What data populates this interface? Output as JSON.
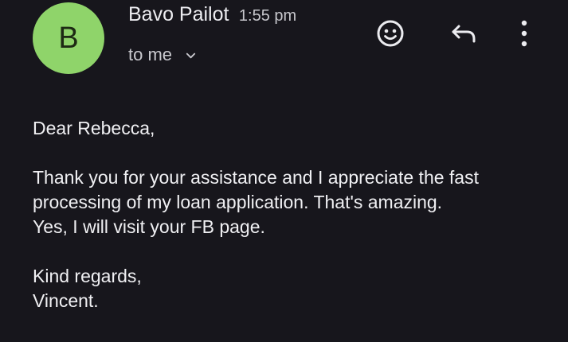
{
  "email": {
    "sender": {
      "avatar_initial": "B",
      "name": "Bavo Pailot",
      "time": "1:55 pm"
    },
    "recipient": "to me",
    "actions": {
      "emoji_icon": "emoji-smile-icon",
      "reply_icon": "reply-icon",
      "more_icon": "more-vert-icon"
    },
    "message": {
      "greeting": "Dear Rebecca,",
      "body_lines": [
        "Thank you for your assistance and I appreciate the fast",
        "processing of my loan application. That's amazing.",
        "Yes, I will visit your FB page."
      ],
      "closing": "Kind regards,",
      "signature": "Vincent."
    }
  },
  "theme": {
    "background": "#17161c",
    "avatar_color": "#8fd46a",
    "text_color": "#ececf0"
  }
}
